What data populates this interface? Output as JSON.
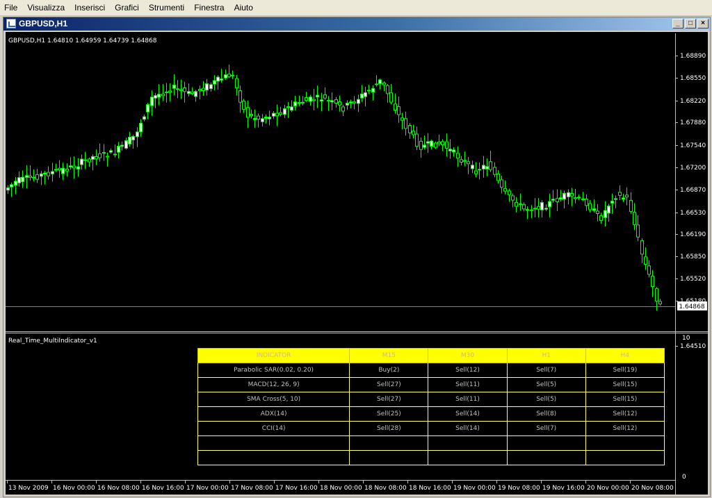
{
  "menu": [
    "File",
    "Visualizza",
    "Inserisci",
    "Grafici",
    "Strumenti",
    "Finestra",
    "Aiuto"
  ],
  "window": {
    "title": "GBPUSD,H1",
    "min": "_",
    "max": "□",
    "close": "×"
  },
  "chart": {
    "info": "GBPUSD,H1  1.64810 1.64959 1.64739 1.64868",
    "price_labels": [
      "1.68890",
      "1.68550",
      "1.68220",
      "1.67880",
      "1.67540",
      "1.67200",
      "1.66870",
      "1.66530",
      "1.66190",
      "1.65850",
      "1.65520",
      "1.65180",
      "1.64510"
    ],
    "current_price": "1.64868",
    "time_labels": [
      "13 Nov 2009",
      "16 Nov 00:00",
      "16 Nov 08:00",
      "16 Nov 16:00",
      "17 Nov 00:00",
      "17 Nov 08:00",
      "17 Nov 16:00",
      "18 Nov 00:00",
      "18 Nov 08:00",
      "18 Nov 16:00",
      "19 Nov 00:00",
      "19 Nov 08:00",
      "19 Nov 16:00",
      "20 Nov 00:00",
      "20 Nov 08:00"
    ],
    "colors": {
      "bull": "#ffffff",
      "bear": "#000000",
      "wick": "#00ff00",
      "grid": "#808080"
    }
  },
  "indicator": {
    "name": "Real_Time_MultiIndicator_v1",
    "scale_max": "10",
    "scale_min": "0",
    "headers": [
      "INDICATOR",
      "M15",
      "M30",
      "H1",
      "H4"
    ],
    "rows": [
      [
        "Parabolic SAR(0.02, 0.20)",
        "Buy(2)",
        "Sell(12)",
        "Sell(7)",
        "Sell(19)"
      ],
      [
        "MACD(12, 26, 9)",
        "Sell(27)",
        "Sell(11)",
        "Sell(5)",
        "Sell(15)"
      ],
      [
        "SMA Cross(5, 10)",
        "Sell(27)",
        "Sell(11)",
        "Sell(5)",
        "Sell(15)"
      ],
      [
        "ADX(14)",
        "Sell(25)",
        "Sell(14)",
        "Sell(8)",
        "Sell(12)"
      ],
      [
        "CCI(14)",
        "Sell(28)",
        "Sell(14)",
        "Sell(7)",
        "Sell(12)"
      ],
      [
        "",
        "",
        "",
        "",
        ""
      ],
      [
        "",
        "",
        "",
        "",
        ""
      ]
    ]
  }
}
